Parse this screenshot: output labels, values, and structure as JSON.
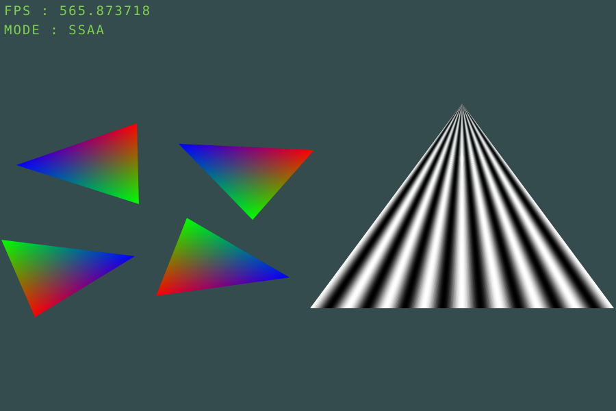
{
  "hud": {
    "fps_label": "FPS",
    "fps_value": "565.873718",
    "mode_label": "MODE",
    "mode_value": "SSAA",
    "separator": ":"
  },
  "colors": {
    "background": "#344c4d",
    "hud_text": "#7ecf4e",
    "vertex_red": "#ff0000",
    "vertex_green": "#00ff00",
    "vertex_blue": "#0000ff",
    "stripe_light": "#ffffff",
    "stripe_dark": "#000000"
  },
  "scene": {
    "rgb_triangles": 4,
    "stripe_cycles": 8
  }
}
